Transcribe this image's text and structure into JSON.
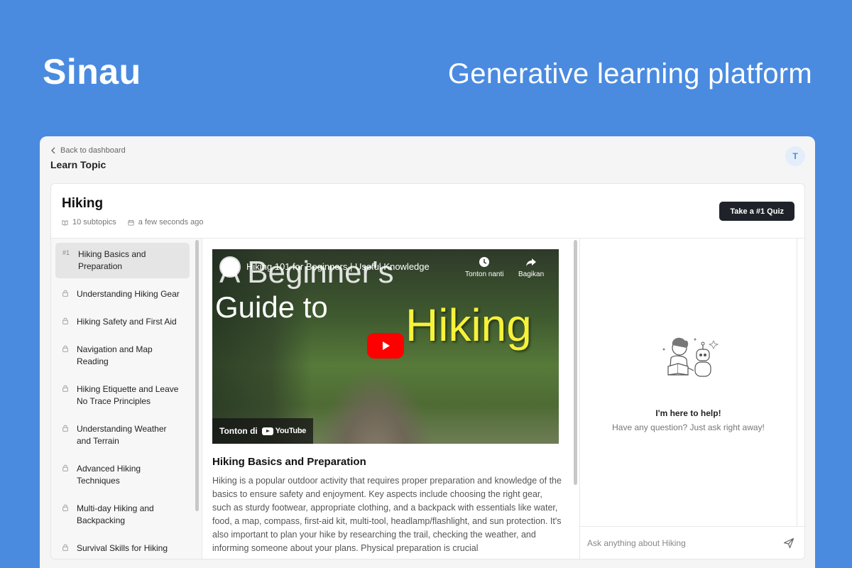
{
  "brand": "Sinau",
  "tagline": "Generative learning platform",
  "header": {
    "back_label": "Back to dashboard",
    "page_title": "Learn Topic",
    "avatar_initial": "T"
  },
  "topic": {
    "title": "Hiking",
    "subtopics": "10 subtopics",
    "updated": "a few seconds ago",
    "quiz_label": "Take a #1 Quiz"
  },
  "sidebar": {
    "items": [
      {
        "num": "#1",
        "label": "Hiking Basics and Preparation",
        "locked": false,
        "active": true
      },
      {
        "label": "Understanding Hiking Gear",
        "locked": true
      },
      {
        "label": "Hiking Safety and First Aid",
        "locked": true
      },
      {
        "label": "Navigation and Map Reading",
        "locked": true
      },
      {
        "label": "Hiking Etiquette and Leave No Trace Principles",
        "locked": true
      },
      {
        "label": "Understanding Weather and Terrain",
        "locked": true
      },
      {
        "label": "Advanced Hiking Techniques",
        "locked": true
      },
      {
        "label": "Multi-day Hiking and Backpacking",
        "locked": true
      },
      {
        "label": "Survival Skills for Hiking",
        "locked": true
      }
    ]
  },
  "video": {
    "title": "Hiking 101 for Beginners | Useful Knowledge",
    "watch_later": "Tonton nanti",
    "share": "Bagikan",
    "overlay_line1": "A Beginner's",
    "overlay_line2": "Guide to",
    "overlay_line3": "Hiking",
    "watch_on": "Tonton di",
    "youtube": "YouTube"
  },
  "content": {
    "section_title": "Hiking Basics and Preparation",
    "section_text": "Hiking is a popular outdoor activity that requires proper preparation and knowledge of the basics to ensure safety and enjoyment. Key aspects include choosing the right gear, such as sturdy footwear, appropriate clothing, and a backpack with essentials like water, food, a map, compass, first-aid kit, multi-tool, headlamp/flashlight, and sun protection. It's also important to plan your hike by researching the trail, checking the weather, and informing someone about your plans. Physical preparation is crucial"
  },
  "chat": {
    "help_title": "I'm here to help!",
    "help_subtitle": "Have any question? Just ask right away!",
    "input_placeholder": "Ask anything about Hiking"
  },
  "colors": {
    "background": "#4A8BE0",
    "quiz_button": "#1F2329",
    "play_button": "#FF0000",
    "overlay_highlight": "#F7F23A"
  }
}
